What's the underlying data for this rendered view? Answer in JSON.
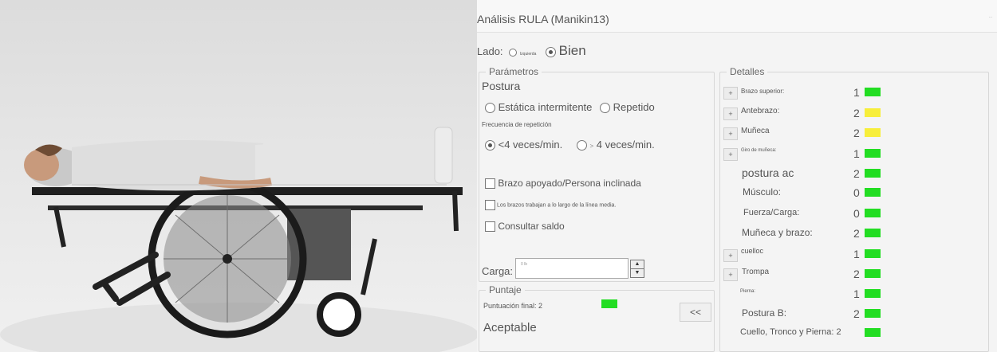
{
  "title": "Análisis RULA (Manikin13)",
  "corner_text": "...",
  "lado": {
    "label": "Lado:",
    "left_label": "Izquierda",
    "right_label": "Bien",
    "selected": "right"
  },
  "parametros": {
    "legend": "Parámetros",
    "postura_label": "Postura",
    "postura_options": [
      "Estática intermitente",
      "Repetido"
    ],
    "frecuencia_label": "Frecuencia de repetición",
    "freq_options": [
      "<4 veces/min.",
      "4 veces/min."
    ],
    "freq_selected": 0,
    "checks": [
      "Brazo apoyado/Persona inclinada",
      "Los brazos trabajan a lo largo de la línea media.",
      "Consultar saldo"
    ],
    "carga_label": "Carga:",
    "carga_value": "0 lb"
  },
  "puntaje": {
    "legend": "Puntaje",
    "final_label": "Puntuación final: 2",
    "result": "Aceptable",
    "back_button": "<<"
  },
  "detalles": {
    "legend": "Detalles",
    "rows": [
      {
        "label": "Brazo superior:",
        "value": "1",
        "color": "#22dd22",
        "plus": true
      },
      {
        "label": "Antebrazo:",
        "value": "2",
        "color": "#f7ee3a",
        "plus": true
      },
      {
        "label": "Muñeca",
        "value": "2",
        "color": "#f7ee3a",
        "plus": true
      },
      {
        "label": "Giro de muñeca:",
        "value": "1",
        "color": "#22dd22",
        "plus": true
      },
      {
        "label": "postura ac",
        "value": "2",
        "color": "#22dd22",
        "plus": false
      },
      {
        "label": "Músculo:",
        "value": "0",
        "color": "#22dd22",
        "plus": false
      },
      {
        "label": "Fuerza/Carga:",
        "value": "0",
        "color": "#22dd22",
        "plus": false
      },
      {
        "label": "Muñeca y brazo:",
        "value": "2",
        "color": "#22dd22",
        "plus": false
      },
      {
        "label": "cuelloc",
        "value": "1",
        "color": "#22dd22",
        "plus": true
      },
      {
        "label": "Trompa",
        "value": "2",
        "color": "#22dd22",
        "plus": true
      },
      {
        "label": "Pierna:",
        "value": "1",
        "color": "#22dd22",
        "plus": false
      },
      {
        "label": "Postura B:",
        "value": "2",
        "color": "#22dd22",
        "plus": false
      },
      {
        "label": "Cuello, Tronco y Pierna: 2",
        "value": "",
        "color": "#22dd22",
        "plus": false
      }
    ]
  },
  "colors": {
    "green": "#22dd22",
    "yellow": "#f7ee3a"
  }
}
